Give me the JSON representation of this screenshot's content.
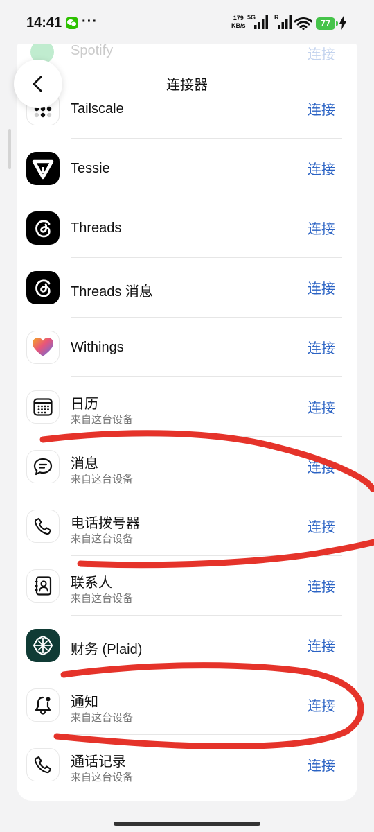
{
  "status": {
    "time": "14:41",
    "more": "···",
    "net_speed_value": "179",
    "net_speed_unit": "KB/s",
    "signal1_label": "5G",
    "signal2_label": "R",
    "battery": "77"
  },
  "header": {
    "title": "连接器"
  },
  "connect_label": "连接",
  "ghost_item": {
    "label": "Spotify"
  },
  "items": [
    {
      "label": "Tailscale",
      "icon": "tailscale-logo-icon"
    },
    {
      "label": "Tessie",
      "icon": "tessie-logo-icon"
    },
    {
      "label": "Threads",
      "icon": "threads-logo-icon"
    },
    {
      "label": "Threads 消息",
      "icon": "threads-logo-icon"
    },
    {
      "label": "Withings",
      "icon": "withings-heart-icon"
    },
    {
      "label": "日历",
      "subtitle": "来自这台设备",
      "icon": "calendar-icon"
    },
    {
      "label": "消息",
      "subtitle": "来自这台设备",
      "icon": "message-bubble-icon"
    },
    {
      "label": "电话拨号器",
      "subtitle": "来自这台设备",
      "icon": "phone-icon"
    },
    {
      "label": "联系人",
      "subtitle": "来自这台设备",
      "icon": "contacts-book-icon"
    },
    {
      "label": "财务 (Plaid)",
      "icon": "plaid-logo-icon"
    },
    {
      "label": "通知",
      "subtitle": "来自这台设备",
      "icon": "bell-icon"
    },
    {
      "label": "通话记录",
      "subtitle": "来自这台设备",
      "icon": "phone-icon"
    }
  ],
  "colors": {
    "accent": "#2b63c4",
    "annotation": "#e5332a",
    "battery": "#45c34a"
  }
}
